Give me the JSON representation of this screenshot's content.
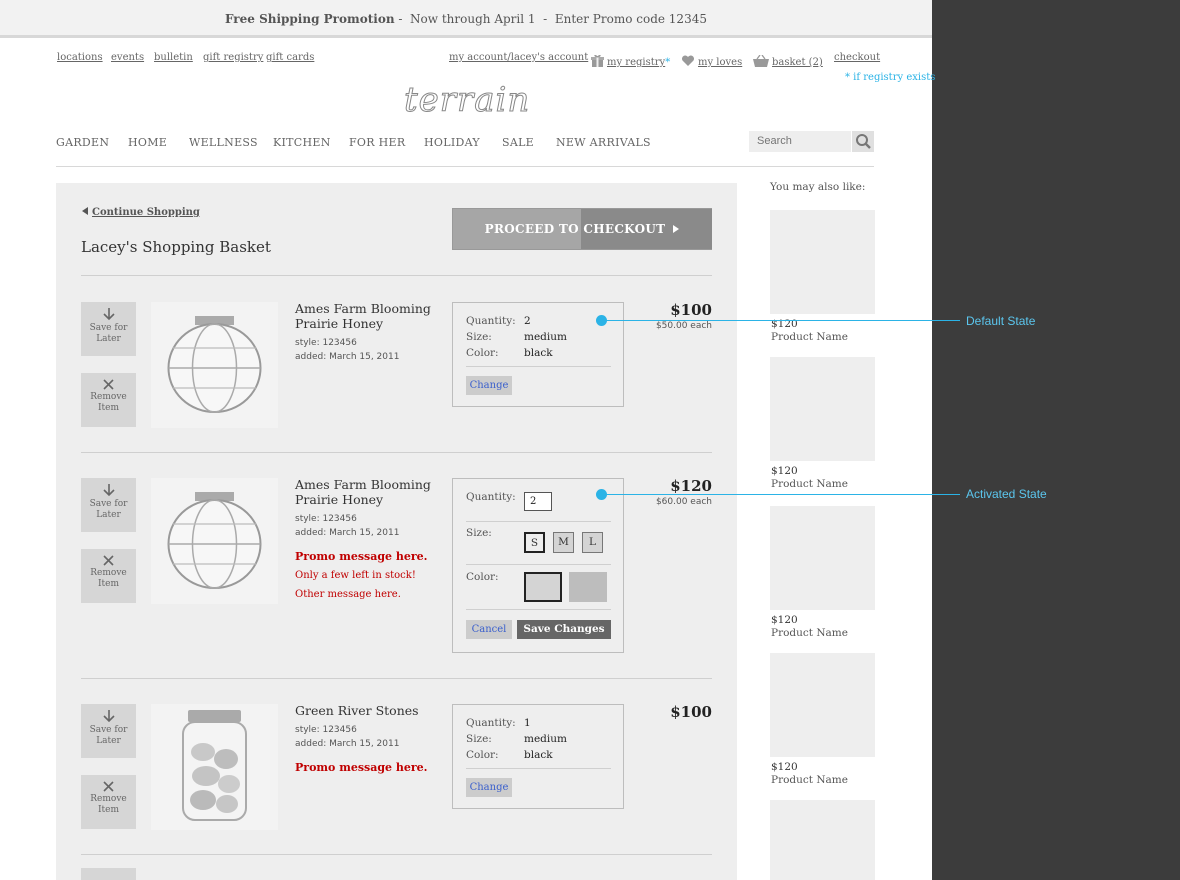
{
  "promo": {
    "bold": "Free Shipping Promotion",
    "rest": " -  Now through April 1  -  Enter Promo code 12345"
  },
  "util_left": [
    "locations",
    "events",
    "bulletin",
    "gift registry",
    "gift cards"
  ],
  "util_right": {
    "account": "my account/lacey's account",
    "registry": "my registry",
    "registry_star": "*",
    "loves": "my loves",
    "basket": "basket (2)",
    "checkout": "checkout"
  },
  "registry_note": "* if registry exists",
  "logo": "terrain",
  "nav": [
    "GARDEN",
    "HOME",
    "WELLNESS",
    "KITCHEN",
    "FOR HER",
    "HOLIDAY",
    "SALE",
    "NEW ARRIVALS"
  ],
  "search": {
    "placeholder": "Search"
  },
  "basket": {
    "continue": "Continue Shopping",
    "title": "Lacey's Shopping Basket",
    "checkout": "PROCEED TO CHECKOUT"
  },
  "side_buttons": {
    "save": "Save for Later",
    "remove": "Remove Item"
  },
  "items": [
    {
      "name": "Ames Farm Blooming Prairie Honey",
      "style": "style: 123456",
      "added": "added: March 15, 2011",
      "quantity_label": "Quantity:",
      "quantity": "2",
      "size_label": "Size:",
      "size": "medium",
      "color_label": "Color:",
      "color": "black",
      "change": "Change",
      "price": "$100",
      "each": "$50.00 each"
    },
    {
      "name": "Ames Farm Blooming Prairie Honey",
      "style": "style: 123456",
      "added": "added: March 15, 2011",
      "promo": "Promo message here.",
      "stock": "Only a few left in stock!",
      "other": "Other message here.",
      "quantity_label": "Quantity:",
      "quantity": "2",
      "size_label": "Size:",
      "sizes": [
        "S",
        "M",
        "L"
      ],
      "color_label": "Color:",
      "cancel": "Cancel",
      "save": "Save Changes",
      "price": "$120",
      "each": "$60.00 each"
    },
    {
      "name": "Green River Stones",
      "style": "style: 123456",
      "added": "added: March 15, 2011",
      "promo": "Promo message here.",
      "quantity_label": "Quantity:",
      "quantity": "1",
      "size_label": "Size:",
      "size": "medium",
      "color_label": "Color:",
      "color": "black",
      "change": "Change",
      "price": "$100"
    }
  ],
  "recommendations": {
    "title": "You may also like:",
    "items": [
      {
        "price": "$120",
        "name": "Product Name"
      },
      {
        "price": "$120",
        "name": "Product Name"
      },
      {
        "price": "$120",
        "name": "Product Name"
      },
      {
        "price": "$120",
        "name": "Product Name"
      }
    ]
  },
  "callouts": {
    "default": "Default State",
    "activated": "Activated State"
  },
  "colors": {
    "callout": "#2bb3e6",
    "promo_red": "#c00000",
    "link_blue": "#3a5fcc",
    "dark_panel": "#3c3c3c"
  }
}
